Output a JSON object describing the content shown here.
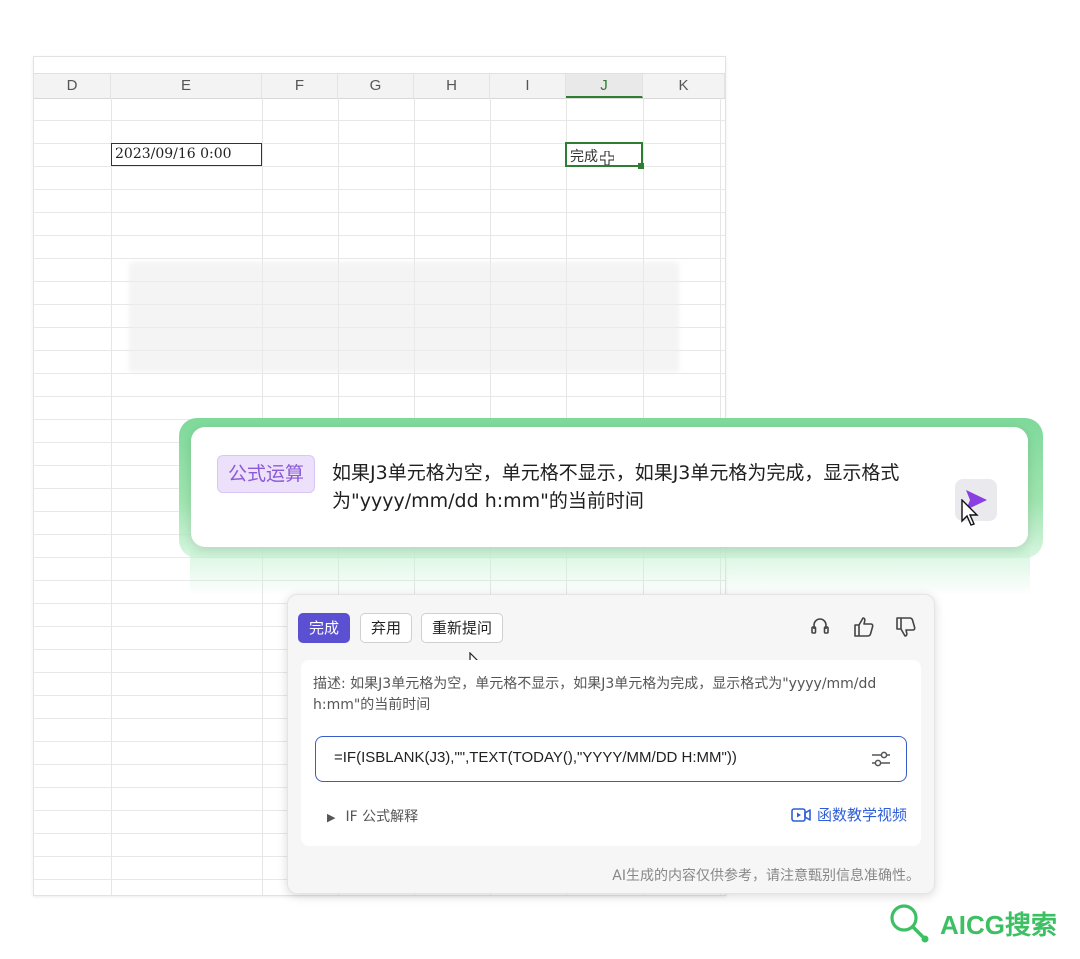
{
  "sheet": {
    "columns": [
      "D",
      "E",
      "F",
      "G",
      "H",
      "I",
      "J",
      "K"
    ],
    "active_column": "J",
    "date_cell": "2023/09/16 0:00",
    "status_cell": "完成"
  },
  "prompt": {
    "tag": "公式运算",
    "text": "如果J3单元格为空，单元格不显示，如果J3单元格为完成，显示格式为\"yyyy/mm/dd h:mm\"的当前时间"
  },
  "result": {
    "buttons": {
      "done": "完成",
      "discard": "弃用",
      "reask": "重新提问"
    },
    "description": "描述: 如果J3单元格为空，单元格不显示，如果J3单元格为完成，显示格式为\"yyyy/mm/dd h:mm\"的当前时间",
    "formula": "=IF(ISBLANK(J3),\"\",TEXT(TODAY(),\"YYYY/MM/DD H:MM\"))",
    "explain": "IF 公式解释",
    "video_link": "函数教学视频",
    "footer": "AI生成的内容仅供参考，请注意甄别信息准确性。"
  },
  "watermark": "AICG搜索",
  "colors": {
    "primary": "#5b4fd2",
    "glow_green": "#7ed99a",
    "tag_purple": "#8a5bd6",
    "cell_green": "#2e7d32",
    "link_blue": "#2f5fd8"
  }
}
